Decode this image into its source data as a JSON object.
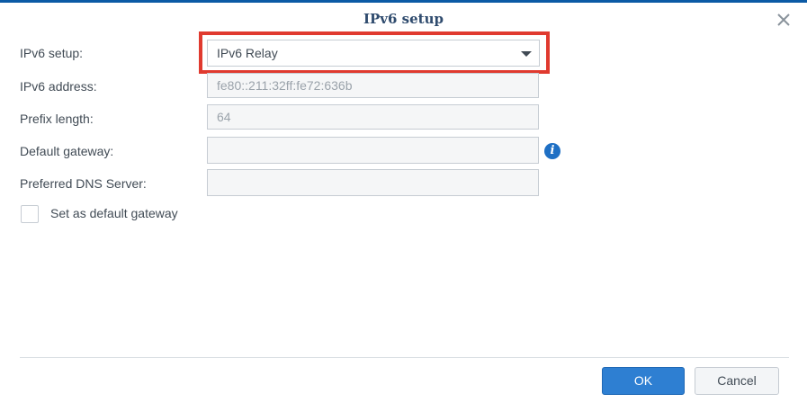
{
  "dialog": {
    "title": "IPv6 setup",
    "close_icon": "close-icon"
  },
  "form": {
    "setup_label": "IPv6 setup:",
    "setup_value": "IPv6 Relay",
    "address_label": "IPv6 address:",
    "address_value": "fe80::211:32ff:fe72:636b",
    "prefix_label": "Prefix length:",
    "prefix_value": "64",
    "gateway_label": "Default gateway:",
    "gateway_value": "",
    "gateway_info_icon": "info-icon",
    "dns_label": "Preferred DNS Server:",
    "dns_value": "",
    "default_gateway_checkbox_label": "Set as default gateway",
    "default_gateway_checked": false
  },
  "footer": {
    "ok_label": "OK",
    "cancel_label": "Cancel"
  },
  "colors": {
    "topbar": "#0b5aa5",
    "highlight": "#e03a2f",
    "primary_button": "#2e7fd2",
    "info_icon": "#1e6fc4"
  }
}
